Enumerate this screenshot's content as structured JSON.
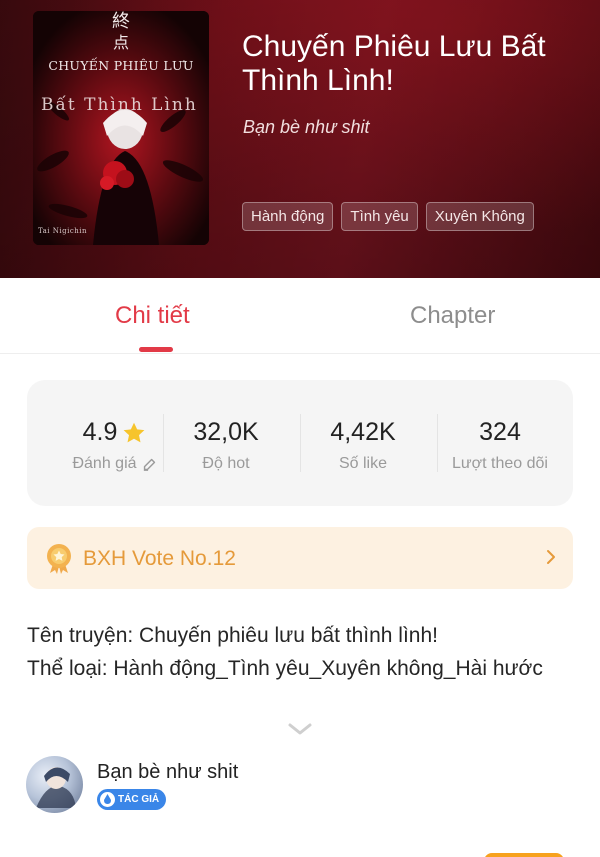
{
  "header": {
    "title": "Chuyến Phiêu Lưu Bất Thình Lình!",
    "author": "Bạn bè như shit",
    "tags": [
      "Hành động",
      "Tình yêu",
      "Xuyên Không"
    ],
    "cover": {
      "kanji_1": "終",
      "kanji_2": "点",
      "title_text": "CHUYẾN PHIÊU LƯU",
      "subtitle_text": "Bất Thình Lình",
      "artist_text": "Tai Nigichin"
    }
  },
  "tabs": [
    {
      "label": "Chi tiết",
      "active": true
    },
    {
      "label": "Chapter",
      "active": false
    }
  ],
  "stats": [
    {
      "value": "4.9",
      "label": "Đánh giá",
      "icon": "star-icon"
    },
    {
      "value": "32,0K",
      "label": "Độ hot"
    },
    {
      "value": "4,42K",
      "label": "Số like"
    },
    {
      "value": "324",
      "label": "Lượt theo dõi"
    }
  ],
  "vote_banner": {
    "text": "BXH Vote No.12",
    "icon": "medal-icon"
  },
  "description": {
    "line1": "Tên truyện: Chuyến phiêu lưu bất thình lình!",
    "line2": "Thể loại: Hành động_Tình yêu_Xuyên không_Hài hước"
  },
  "author_row": {
    "name": "Bạn bè như shit",
    "badge": "TÁC GIẢ"
  },
  "colors": {
    "accent": "#e23a47",
    "vote_text": "#e59a3a",
    "vote_bg": "#fdf1e1",
    "badge_blue": "#3a86e8",
    "header_red": "#6b0f18"
  }
}
